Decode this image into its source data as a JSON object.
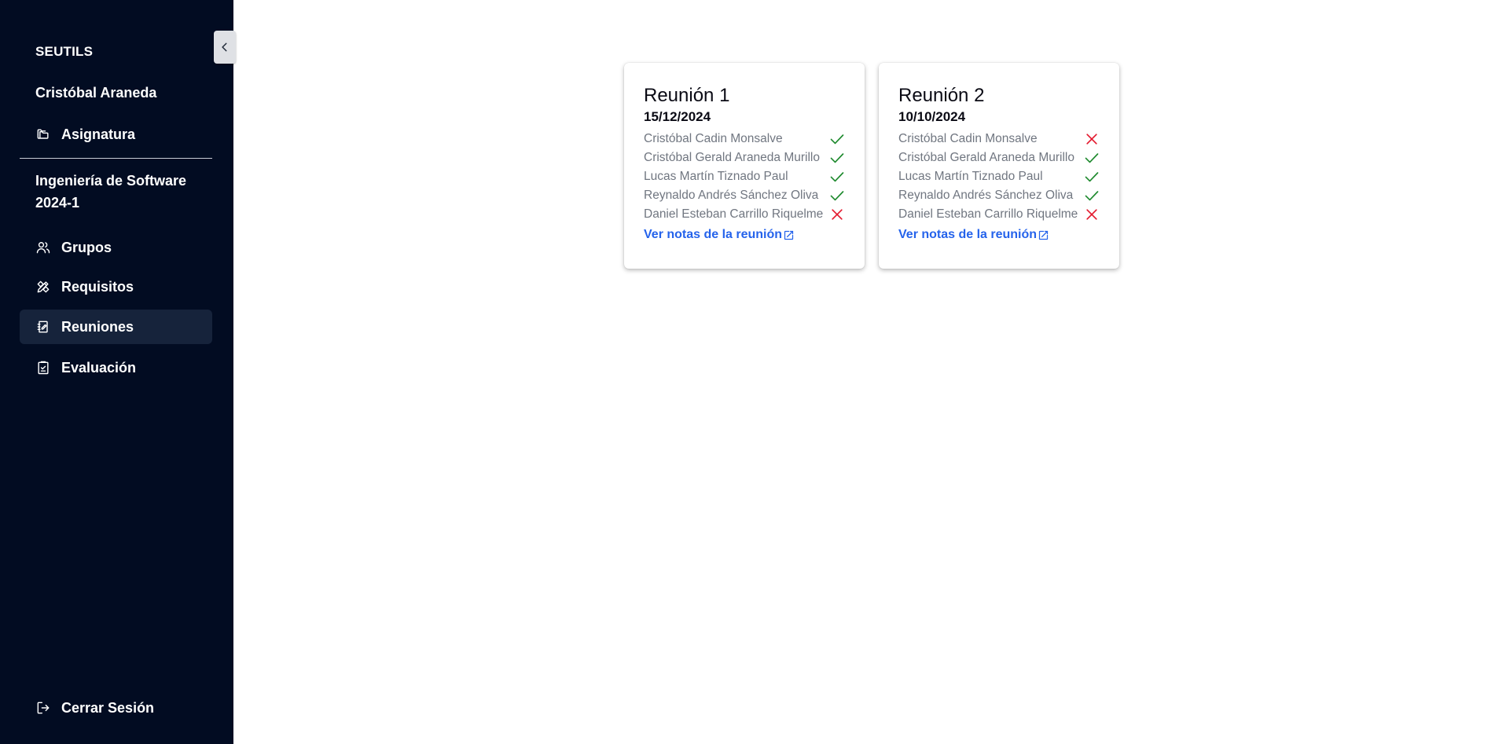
{
  "sidebar": {
    "brand": "SEUTILS",
    "user_name": "Cristóbal Araneda",
    "subject_label": "Asignatura",
    "course_title": "Ingeniería de Software 2024-1",
    "nav": [
      {
        "label": "Grupos",
        "icon": "users-icon"
      },
      {
        "label": "Requisitos",
        "icon": "tools-icon"
      },
      {
        "label": "Reuniones",
        "icon": "notebook-icon",
        "active": true
      },
      {
        "label": "Evaluación",
        "icon": "clipboard-check-icon"
      }
    ],
    "logout_label": "Cerrar Sesión"
  },
  "colors": {
    "sidebar_bg": "#020c22",
    "active_item_bg": "#16233b",
    "present": "#1e8a2e",
    "absent": "#e3182d",
    "link": "#2563eb"
  },
  "meetings": [
    {
      "title": "Reunión 1",
      "date": "15/12/2024",
      "attendees": [
        {
          "name": "Cristóbal Cadin Monsalve",
          "present": true
        },
        {
          "name": "Cristóbal Gerald Araneda Murillo",
          "present": true
        },
        {
          "name": "Lucas Martín Tiznado Paul",
          "present": true
        },
        {
          "name": "Reynaldo Andrés Sánchez Oliva",
          "present": true
        },
        {
          "name": "Daniel Esteban Carrillo Riquelme",
          "present": false
        }
      ],
      "notes_link": "Ver notas de la reunión"
    },
    {
      "title": "Reunión 2",
      "date": "10/10/2024",
      "attendees": [
        {
          "name": "Cristóbal Cadin Monsalve",
          "present": false
        },
        {
          "name": "Cristóbal Gerald Araneda Murillo",
          "present": true
        },
        {
          "name": "Lucas Martín Tiznado Paul",
          "present": true
        },
        {
          "name": "Reynaldo Andrés Sánchez Oliva",
          "present": true
        },
        {
          "name": "Daniel Esteban Carrillo Riquelme",
          "present": false
        }
      ],
      "notes_link": "Ver notas de la reunión"
    }
  ]
}
